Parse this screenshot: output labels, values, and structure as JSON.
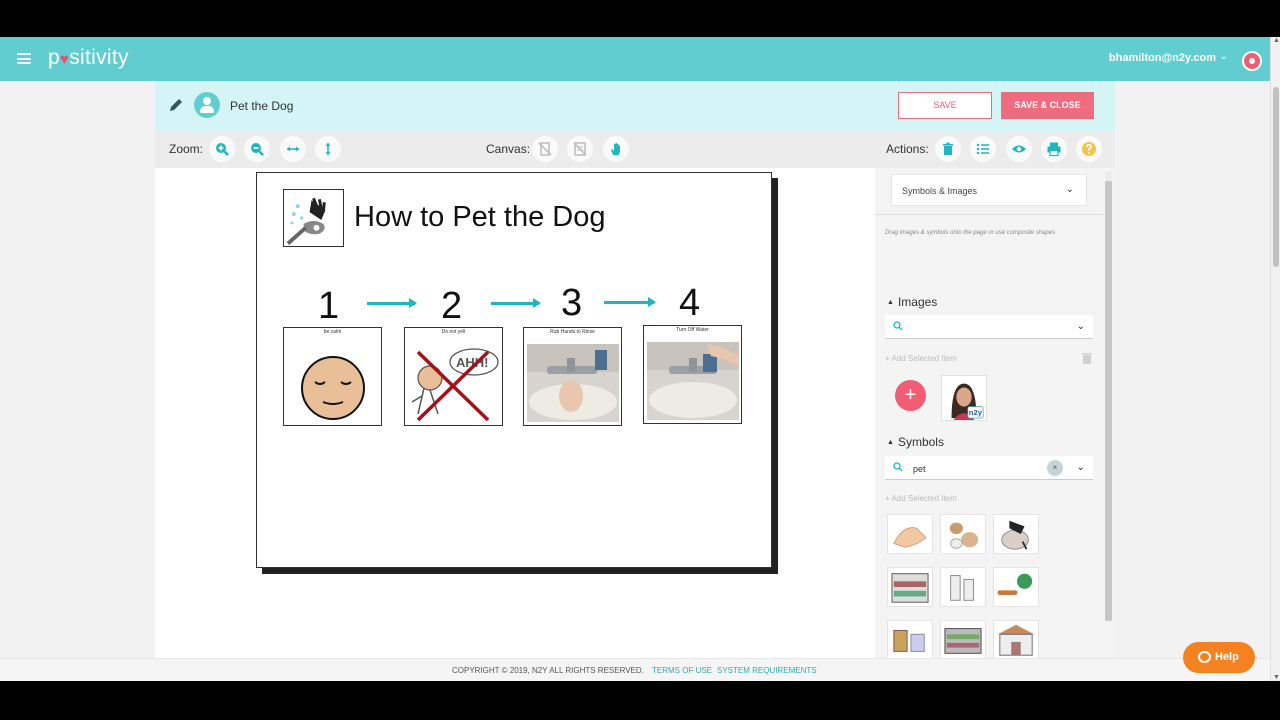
{
  "app": {
    "logo_text_1": "p",
    "logo_heart": "♥",
    "logo_text_2": "sitivity"
  },
  "user": {
    "email": "bhamilton@n2y.com",
    "chevron": "⌄"
  },
  "editor": {
    "doc_title": "Pet the Dog",
    "save_label": "SAVE",
    "save_close_label": "SAVE & CLOSE"
  },
  "toolbar": {
    "zoom_label": "Zoom:",
    "canvas_label": "Canvas:",
    "actions_label": "Actions:",
    "icon_color": "#1fb6c1",
    "help_color": "#f5c34c"
  },
  "page": {
    "title": "How to Pet the Dog",
    "steps": [
      {
        "number": "1",
        "caption": "be calm"
      },
      {
        "number": "2",
        "caption": "Do not yell"
      },
      {
        "number": "3",
        "caption": "Rub Hands to Rinse"
      },
      {
        "number": "4",
        "caption": "Turn Off Water"
      }
    ],
    "ahh_text": "AHH!"
  },
  "sidebar": {
    "dropdown_value": "Symbols & Images",
    "hint": "Drag images & symbols onto the page or use composite shapes",
    "images_heading": "Images",
    "images_search_value": "",
    "add_selected_label": "+ Add Selected Item",
    "symbols_heading": "Symbols",
    "symbols_search_value": "pet",
    "clear_glyph": "×",
    "plus_glyph": "+",
    "n2y_badge": "n2y"
  },
  "footer": {
    "copyright": "COPYRIGHT © 2019, N2Y ALL RIGHTS RESERVED.",
    "terms": "TERMS OF USE",
    "system": "SYSTEM REQUIREMENTS"
  },
  "help": {
    "label": "Help"
  },
  "colors": {
    "brand": "#62cdd1",
    "accent": "#ef5e72",
    "help": "#f58220"
  }
}
